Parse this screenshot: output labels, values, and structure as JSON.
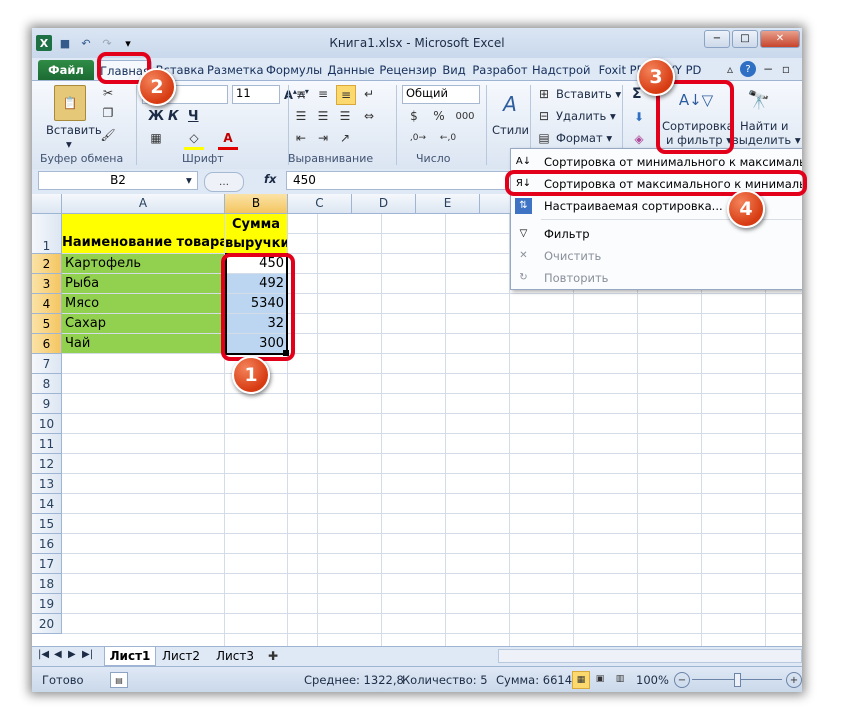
{
  "window": {
    "title": "Книга1.xlsx  -  Microsoft Excel",
    "min_glyph": "−",
    "max_glyph": "□",
    "close_glyph": "✕"
  },
  "qat": {
    "excel_glyph": "X",
    "save_glyph": "💾",
    "undo_glyph": "↶",
    "redo_glyph": "↷",
    "custom_glyph": "▾"
  },
  "tabs": {
    "file": "Файл",
    "home": "Главная",
    "insert": "Вставка",
    "layout": "Разметка",
    "formulas": "Формулы",
    "data": "Данные",
    "review": "Рецензир",
    "view": "Вид",
    "developer": "Разработ",
    "addins": "Надстрой",
    "foxit": "Foxit PD",
    "abbyy": "BYY PD"
  },
  "ribbon": {
    "paste": "Вставить",
    "font_name": "ri",
    "font_size": "11",
    "bold": "Ж",
    "italic": "К",
    "underline": "Ч",
    "number_format": "Общий",
    "styles": "Стили",
    "insert": "Вставить",
    "delete": "Удалить",
    "format": "Формат",
    "sort_line1": "Сортировка",
    "sort_line2": "и фильтр",
    "find_line1": "Найти и",
    "find_line2": "выделить",
    "sigma": "Σ",
    "groups": {
      "clipboard": "Буфер обмена",
      "font": "Шрифт",
      "alignment": "Выравнивание",
      "number": "Число"
    }
  },
  "formula_bar": {
    "name_box": "B2",
    "fx": "fx",
    "value": "450"
  },
  "columns": [
    "A",
    "B",
    "C",
    "D",
    "E"
  ],
  "rows": [
    "1",
    "2",
    "3",
    "4",
    "5",
    "6",
    "7",
    "8",
    "9",
    "10",
    "11",
    "12",
    "13",
    "14",
    "15",
    "16",
    "17",
    "18",
    "19",
    "20"
  ],
  "table": {
    "header_a": "Наименование товара",
    "header_b_line1": "Сумма",
    "header_b_line2": "выручки",
    "items": [
      {
        "name": "Картофель",
        "value": "450"
      },
      {
        "name": "Рыба",
        "value": "492"
      },
      {
        "name": "Мясо",
        "value": "5340"
      },
      {
        "name": "Сахар",
        "value": "32"
      },
      {
        "name": "Чай",
        "value": "300"
      }
    ]
  },
  "menu": {
    "sort_asc": "Сортировка от минимального к максимальному",
    "sort_desc": "Сортировка от максимального к минимальному",
    "custom_sort": "Настраиваемая сортировка...",
    "filter": "Фильтр",
    "clear": "Очистить",
    "reapply": "Повторить"
  },
  "sheets": [
    "Лист1",
    "Лист2",
    "Лист3"
  ],
  "status": {
    "ready": "Готово",
    "average": "Среднее: 1322,8",
    "count": "Количество: 5",
    "sum": "Сумма: 6614",
    "zoom": "100%"
  },
  "badges": [
    "1",
    "2",
    "3",
    "4"
  ],
  "colors": {
    "highlight": "#e3001b",
    "badge": "#e05a2a",
    "green_cells": "#92d050",
    "yellow_header": "#ffff00",
    "selection": "#bcd6f1"
  }
}
